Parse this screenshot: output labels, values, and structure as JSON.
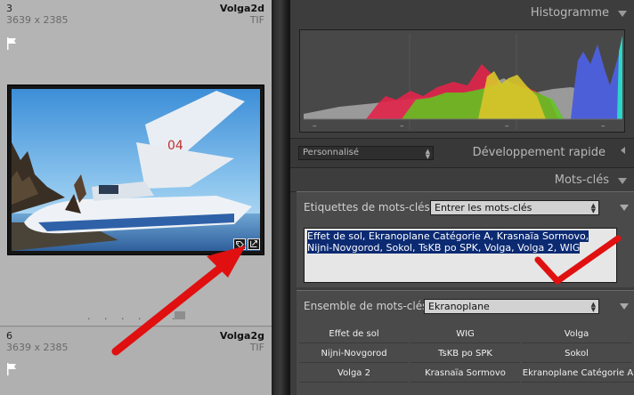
{
  "grid": {
    "cells": [
      {
        "index": "3",
        "dimensions": "3639 x 2385",
        "name": "Volga2d",
        "type": "TIF"
      },
      {
        "index": "6",
        "dimensions": "3639 x 2385",
        "name": "Volga2g",
        "type": "TIF"
      }
    ],
    "dots": ". . . . . ."
  },
  "panel": {
    "histogram_title": "Histogramme",
    "quick_develop": {
      "preset_value": "Personnalisé",
      "title": "Développement rapide"
    },
    "keywords_title": "Mots-clés",
    "keyword_tags": {
      "label": "Etiquettes de mots-clés",
      "mode_value": "Entrer les mots-clés",
      "text": "Effet de sol, Ekranoplane Catégorie A, Krasnaïa Sormovo, Nijni-Novgorod, Sokol, TsKB po SPK, Volga, Volga 2, WIG"
    },
    "keyword_set": {
      "label": "Ensemble de mots-clés",
      "value": "Ekranoplane",
      "keywords": [
        "Effet de sol",
        "WIG",
        "Volga",
        "Nijni-Novgorod",
        "TsKB po SPK",
        "Sokol",
        "Volga 2",
        "Krasnaïa Sormovo",
        "Ekranoplane Catégorie A"
      ]
    }
  },
  "icons": {
    "flag": "flag-icon",
    "keyword_badge": "keyword-tag-icon",
    "crop_badge": "crop-adjust-icon",
    "collapse": "triangle-down-icon",
    "expand": "triangle-left-icon"
  },
  "colors": {
    "annotation_red": "#e01010",
    "selection_blue": "#0b2a72",
    "histogram_red": "#e2234a",
    "histogram_green": "#5ec81e",
    "histogram_yellow": "#d9c52a",
    "histogram_blue": "#4d5fd8",
    "histogram_cyan": "#2bd6c8"
  }
}
